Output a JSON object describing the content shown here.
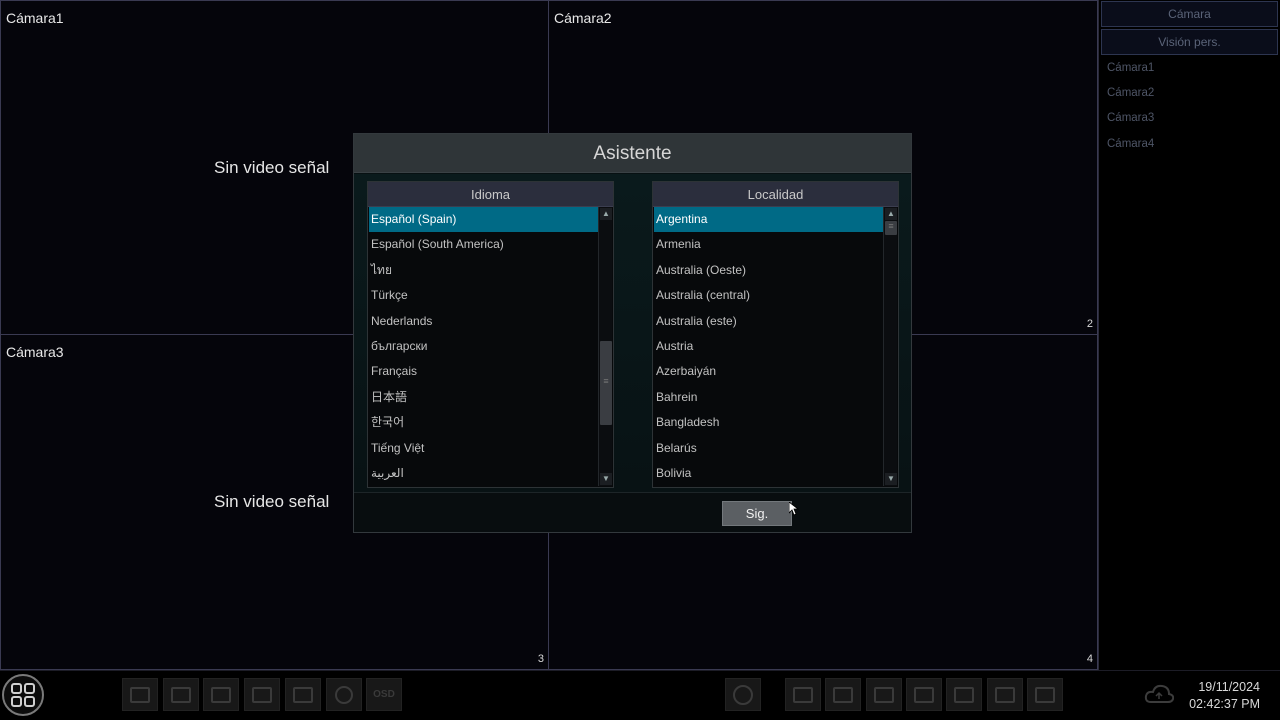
{
  "grid": {
    "cameras": [
      {
        "label": "Cámara1",
        "number": "",
        "no_signal": "Sin video señal"
      },
      {
        "label": "Cámara2",
        "number": "2",
        "no_signal": ""
      },
      {
        "label": "Cámara3",
        "number": "3",
        "no_signal": "Sin video señal"
      },
      {
        "label": "",
        "number": "4",
        "no_signal": ""
      }
    ]
  },
  "right_panel": {
    "tabs": [
      "Cámara",
      "Visión pers."
    ],
    "items": [
      "Cámara1",
      "Cámara2",
      "Cámara3",
      "Cámara4"
    ]
  },
  "dialog": {
    "title": "Asistente",
    "language": {
      "header": "Idioma",
      "selected_index": 0,
      "items": [
        "Español (Spain)",
        "Español (South America)",
        "ไทย",
        "Türkçe",
        "Nederlands",
        "български",
        "Français",
        "日本語",
        "한국어",
        "Tiếng Việt",
        "العربية"
      ],
      "scroll_position": 0.72
    },
    "locality": {
      "header": "Localidad",
      "selected_index": 0,
      "items": [
        "Argentina",
        "Armenia",
        "Australia (Oeste)",
        "Australia (central)",
        "Australia (este)",
        "Austria",
        "Azerbaiyán",
        "Bahrein",
        "Bangladesh",
        "Belarús",
        "Bolivia"
      ],
      "scroll_position": 0.0
    },
    "next_button": "Sig."
  },
  "toolbar": {
    "osd_label": "OSD",
    "date": "19/11/2024",
    "time": "02:42:37 PM"
  },
  "icons": {
    "menu": "grid-menu-icon",
    "cloud": "cloud-icon"
  },
  "colors": {
    "selection": "#006a86",
    "dialog_title_bg": "#2f3538",
    "list_header_bg": "#2b2e3d"
  }
}
